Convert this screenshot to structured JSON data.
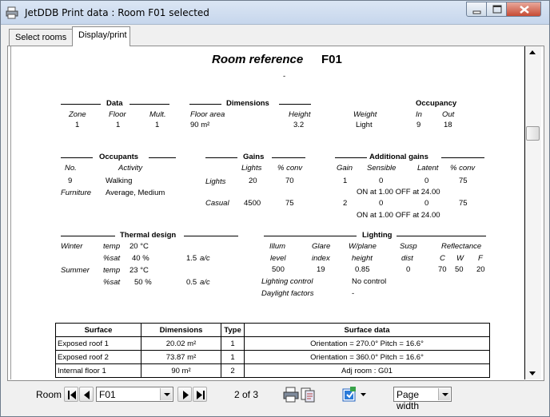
{
  "window": {
    "title": "JetDDB Print data : Room F01 selected"
  },
  "tabs": [
    {
      "label": "Select rooms"
    },
    {
      "label": "Display/print"
    }
  ],
  "report": {
    "heading_label": "Room reference",
    "heading_value": "F01",
    "sub": "-",
    "data": {
      "title": "Data",
      "zone_h": "Zone",
      "floor_h": "Floor",
      "mult_h": "Mult.",
      "zone": "1",
      "floor": "1",
      "mult": "1"
    },
    "dimensions": {
      "title": "Dimensions",
      "area_h": "Floor area",
      "height_h": "Height",
      "area": "90 m²",
      "height": "3.2"
    },
    "occupancy": {
      "title": "Occupancy",
      "weight_h": "Weight",
      "in_h": "In",
      "out_h": "Out",
      "weight": "Light",
      "in": "9",
      "out": "18"
    },
    "occupants": {
      "title": "Occupants",
      "no_h": "No.",
      "activity_h": "Activity",
      "no": "9",
      "activity": "Walking",
      "furniture_h": "Furniture",
      "furniture": "Average, Medium"
    },
    "gains": {
      "title": "Gains",
      "lights_h": "Lights",
      "conv_h": "% conv",
      "rows": [
        {
          "label": "Lights",
          "value": "20",
          "conv": "70"
        },
        {
          "label": "Casual",
          "value": "4500",
          "conv": "75"
        }
      ]
    },
    "additional": {
      "title": "Additional gains",
      "gain_h": "Gain",
      "sensible_h": "Sensible",
      "latent_h": "Latent",
      "conv_h": "% conv",
      "rows": [
        {
          "gain": "1",
          "sensible": "0",
          "latent": "0",
          "conv": "75",
          "schedule": "ON at 1.00 OFF at 24.00"
        },
        {
          "gain": "2",
          "sensible": "0",
          "latent": "0",
          "conv": "75",
          "schedule": "ON at 1.00 OFF at 24.00"
        }
      ]
    },
    "thermal": {
      "title": "Thermal design",
      "winter": "Winter",
      "summer": "Summer",
      "temp": "temp",
      "sat": "%sat",
      "w_temp": "20 °C",
      "w_sat": "40 %",
      "w_ac": "1.5",
      "s_temp": "23 °C",
      "s_sat": "50 %",
      "s_ac": "0.5",
      "ac_unit": "a/c"
    },
    "lighting": {
      "title": "Lighting",
      "illum_h": "Illum",
      "level_h": "level",
      "glare_h": "Glare",
      "index_h": "index",
      "wplane_h": "W/plane",
      "height_h": "height",
      "susp_h": "Susp",
      "dist_h": "dist",
      "refl_h": "Reflectance",
      "c_h": "C",
      "w_h": "W",
      "f_h": "F",
      "level": "500",
      "index": "19",
      "height": "0.85",
      "dist": "0",
      "c": "70",
      "w": "50",
      "f": "20",
      "control_h": "Lighting control",
      "control": "No control",
      "daylight_h": "Daylight factors",
      "daylight": "-"
    },
    "surface_table": {
      "headers": [
        "Surface",
        "Dimensions",
        "Type",
        "Surface data"
      ],
      "rows": [
        [
          "Exposed roof 1",
          "20.02 m²",
          "1",
          "Orientation = 270.0°  Pitch = 16.6°"
        ],
        [
          "Exposed roof 2",
          "73.87 m²",
          "1",
          "Orientation = 360.0°  Pitch = 16.6°"
        ],
        [
          "Internal floor 1",
          "90 m²",
          "2",
          "Adj room : G01"
        ]
      ]
    }
  },
  "toolbar": {
    "room_label": "Room",
    "room_value": "F01",
    "page_status": "2 of 3",
    "zoom_value": "Page width"
  },
  "icons": [
    "printer-icon",
    "first-page-icon",
    "prev-icon",
    "next-icon",
    "last-page-icon",
    "print-icon",
    "copy-icon",
    "export-icon",
    "minimize-icon",
    "maximize-icon",
    "close-icon"
  ]
}
